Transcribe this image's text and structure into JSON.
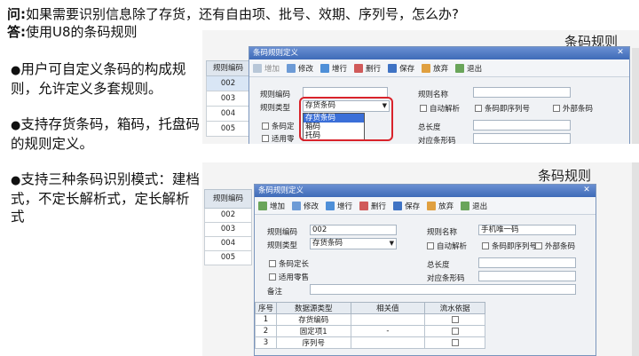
{
  "question": {
    "prefix": "问:",
    "text": "如果需要识别信息除了存货，还有自由项、批号、效期、序列号，怎么办?"
  },
  "answer": {
    "prefix": "答:",
    "text": "使用U8的条码规则"
  },
  "bullets": [
    "用户可自定义条码的构成规则，允许定义多套规则。",
    "支持存货条码，箱码，托盘码的规则定义。",
    "支持三种条码识别模式：建档式，不定长解析式，定长解析式"
  ],
  "bullet_symbol": "●",
  "screen1": {
    "page_title": "条码规则",
    "left_table": {
      "header": "规则编码",
      "rows": [
        "002",
        "003",
        "004",
        "005"
      ]
    },
    "dialog_title": "条码规则定义",
    "toolbar": [
      "增加",
      "修改",
      "增行",
      "删行",
      "保存",
      "放弃",
      "退出"
    ],
    "labels": {
      "rule_code": "规则编码",
      "rule_name": "规则名称",
      "rule_type": "规则类型",
      "auto_parse": "自动解析",
      "barcode_seq": "条码即序列号",
      "external_barcode": "外部条码",
      "barcode_fixed": "条码定",
      "applicable_retail": "适用零",
      "total_length": "总长度",
      "corresponding_barcode": "对应条形码"
    },
    "rule_type_value": "存货条码",
    "dropdown_options": [
      "存货条码",
      "箱码",
      "托码"
    ]
  },
  "screen2": {
    "page_title": "条码规则",
    "left_table": {
      "header": "规则编码",
      "rows": [
        "002",
        "003",
        "004",
        "005"
      ]
    },
    "dialog_title": "条码规则定义",
    "toolbar": [
      "增加",
      "修改",
      "增行",
      "删行",
      "保存",
      "放弃",
      "退出"
    ],
    "labels": {
      "rule_code": "规则编码",
      "rule_name": "规则名称",
      "rule_type": "规则类型",
      "auto_parse": "自动解析",
      "barcode_seq": "条码即序列号",
      "external_barcode": "外部条码",
      "barcode_fixed_length": "条码定长",
      "applicable_retail": "适用零售",
      "total_length": "总长度",
      "corresponding_barcode": "对应条形码",
      "remark": "备注"
    },
    "rule_code_value": "002",
    "rule_name_value": "手机唯一码",
    "rule_type_value": "存货条码",
    "grid": {
      "headers": [
        "序号",
        "数据源类型",
        "相关值",
        "流水依据"
      ],
      "rows": [
        {
          "no": "1",
          "type": "存货编码",
          "value": ""
        },
        {
          "no": "2",
          "type": "固定项1",
          "value": "-"
        },
        {
          "no": "3",
          "type": "序列号",
          "value": ""
        }
      ]
    }
  },
  "colors": {
    "titlebar": "#4a77c4",
    "highlight": "#3b6fd8",
    "red_box": "#d9232b"
  }
}
